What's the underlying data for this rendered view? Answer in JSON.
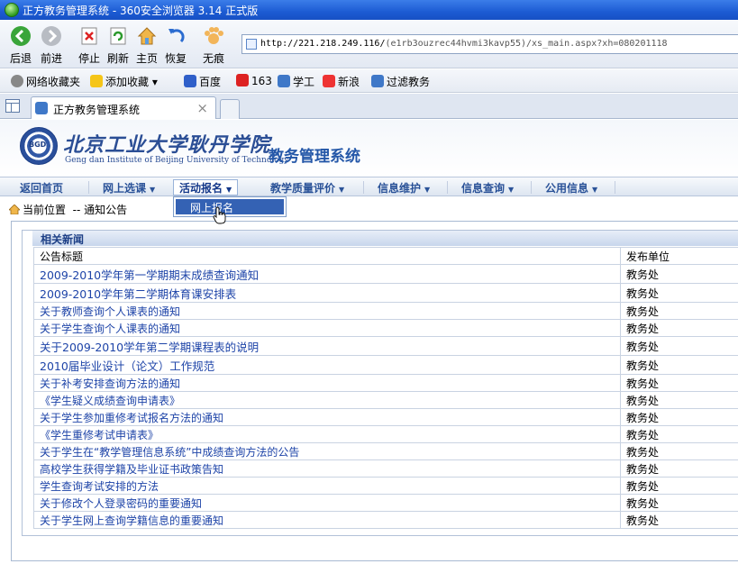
{
  "window": {
    "title": "正方教务管理系统 - 360安全浏览器 3.14 正式版"
  },
  "toolbar": {
    "back": "后退",
    "forward": "前进",
    "stop": "停止",
    "refresh": "刷新",
    "home": "主页",
    "restore": "恢复",
    "traceless": "无痕",
    "address_host": "http://221.218.249.116/",
    "address_path": "(e1rb3ouzrec44hvmi3kavp55)/xs_main.aspx?xh=080201118"
  },
  "favorites": {
    "items": [
      "网络收藏夹",
      "添加收藏",
      "百度",
      "163",
      "学工",
      "新浪",
      "过滤教务"
    ]
  },
  "tabs": {
    "active_label": "正方教务管理系统",
    "close": "×"
  },
  "site": {
    "school_cn": "北京工业大学耿丹学院",
    "school_en": "Geng dan Institute of Beijing University of Technology",
    "system_title": "教务管理系统"
  },
  "nav": {
    "items": [
      "返回首页",
      "网上选课",
      "活动报名",
      "教学质量评价",
      "信息维护",
      "信息查询",
      "公用信息"
    ],
    "dropdown_item": "网上报名"
  },
  "breadcrumb": {
    "label": "当前位置",
    "current": "-- 通知公告"
  },
  "news": {
    "panel_title": "相关新闻",
    "col_title": "公告标题",
    "col_dept": "发布单位",
    "rows": [
      {
        "title": "2009-2010学年第一学期期末成绩查询通知",
        "dept": "教务处"
      },
      {
        "title": "2009-2010学年第二学期体育课安排表",
        "dept": "教务处"
      },
      {
        "title": "关于教师查询个人课表的通知",
        "dept": "教务处"
      },
      {
        "title": "关于学生查询个人课表的通知",
        "dept": "教务处"
      },
      {
        "title": "关于2009-2010学年第二学期课程表的说明",
        "dept": "教务处"
      },
      {
        "title": "2010届毕业设计（论文）工作规范",
        "dept": "教务处"
      },
      {
        "title": "关于补考安排查询方法的通知",
        "dept": "教务处"
      },
      {
        "title": "《学生疑义成绩查询申请表》",
        "dept": "教务处"
      },
      {
        "title": "关于学生参加重修考试报名方法的通知",
        "dept": "教务处"
      },
      {
        "title": "《学生重修考试申请表》",
        "dept": "教务处"
      },
      {
        "title": "关于学生在“教学管理信息系统”中成绩查询方法的公告",
        "dept": "教务处"
      },
      {
        "title": "高校学生获得学籍及毕业证书政策告知",
        "dept": "教务处"
      },
      {
        "title": "学生查询考试安排的方法",
        "dept": "教务处"
      },
      {
        "title": "关于修改个人登录密码的重要通知",
        "dept": "教务处"
      },
      {
        "title": "关于学生网上查询学籍信息的重要通知",
        "dept": "教务处"
      }
    ]
  }
}
